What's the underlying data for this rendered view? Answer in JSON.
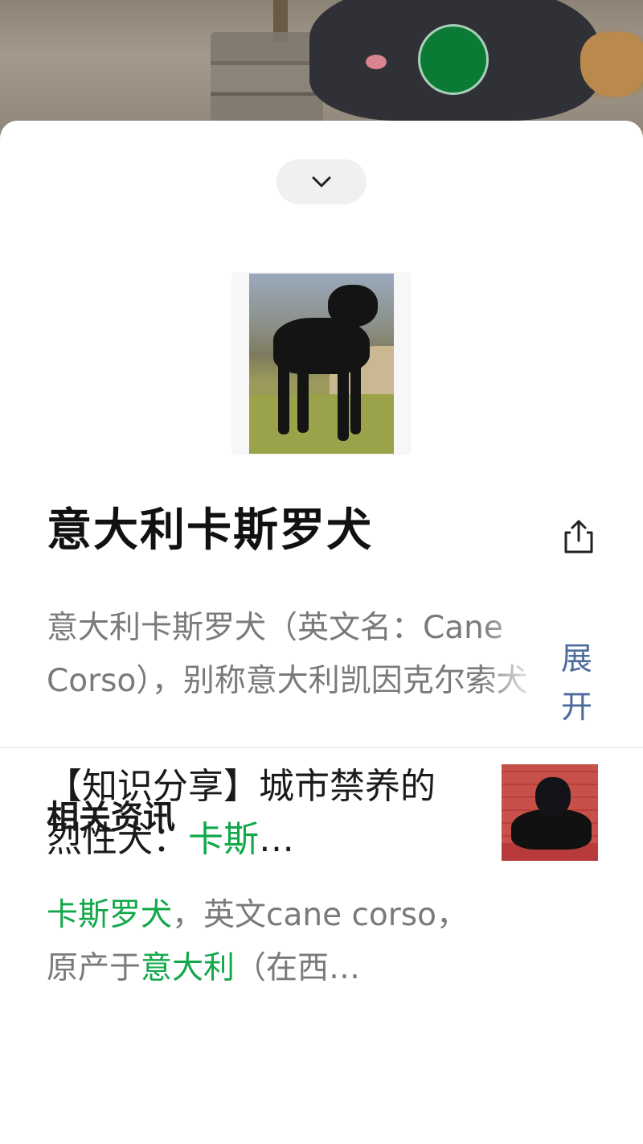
{
  "colors": {
    "accent_green": "#11a84a",
    "link_blue": "#4c6c9c",
    "status_dot": "#0a7a35"
  },
  "entry": {
    "title": "意大利卡斯罗犬",
    "summary": "意大利卡斯罗犬（英文名：Cane Corso），别称意大利凯因克尔索犬",
    "expand_label": "展开",
    "image_icon": "dog-photo-icon"
  },
  "related_news": {
    "heading": "相关资讯",
    "items": [
      {
        "title_prefix": "【知识分享】城市禁养的烈性犬：",
        "title_highlight": "卡斯",
        "title_suffix": "…",
        "snippet_hl1": "卡斯罗犬",
        "snippet_mid": "，英文cane corso，原产于",
        "snippet_hl2": "意大利",
        "snippet_tail": "（在西…"
      }
    ]
  },
  "icons": {
    "collapse": "chevron-down-icon",
    "share": "share-icon"
  }
}
